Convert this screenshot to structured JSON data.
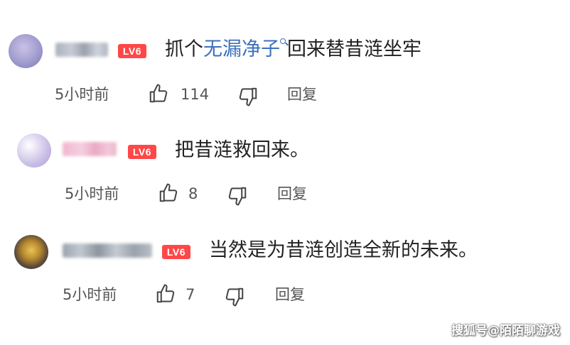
{
  "comments": [
    {
      "level_badge": "LV6",
      "text_pre": "抓个",
      "text_link": "无漏净子",
      "text_post": "回来替昔涟坐牢",
      "time": "5小时前",
      "likes": "114",
      "reply": "回复"
    },
    {
      "level_badge": "LV6",
      "text": "把昔涟救回来。",
      "time": "5小时前",
      "likes": "8",
      "reply": "回复"
    },
    {
      "level_badge": "LV6",
      "text": "当然是为昔涟创造全新的未来。",
      "time": "5小时前",
      "likes": "7",
      "reply": "回复"
    }
  ],
  "watermark": "搜狐号@陌陌聊游戏",
  "colors": {
    "badge": "#ff4747",
    "link": "#3c6fbf",
    "text": "#222222",
    "meta": "#555555"
  },
  "icons": [
    "thumbs-up-icon",
    "thumbs-down-icon",
    "search-icon"
  ]
}
